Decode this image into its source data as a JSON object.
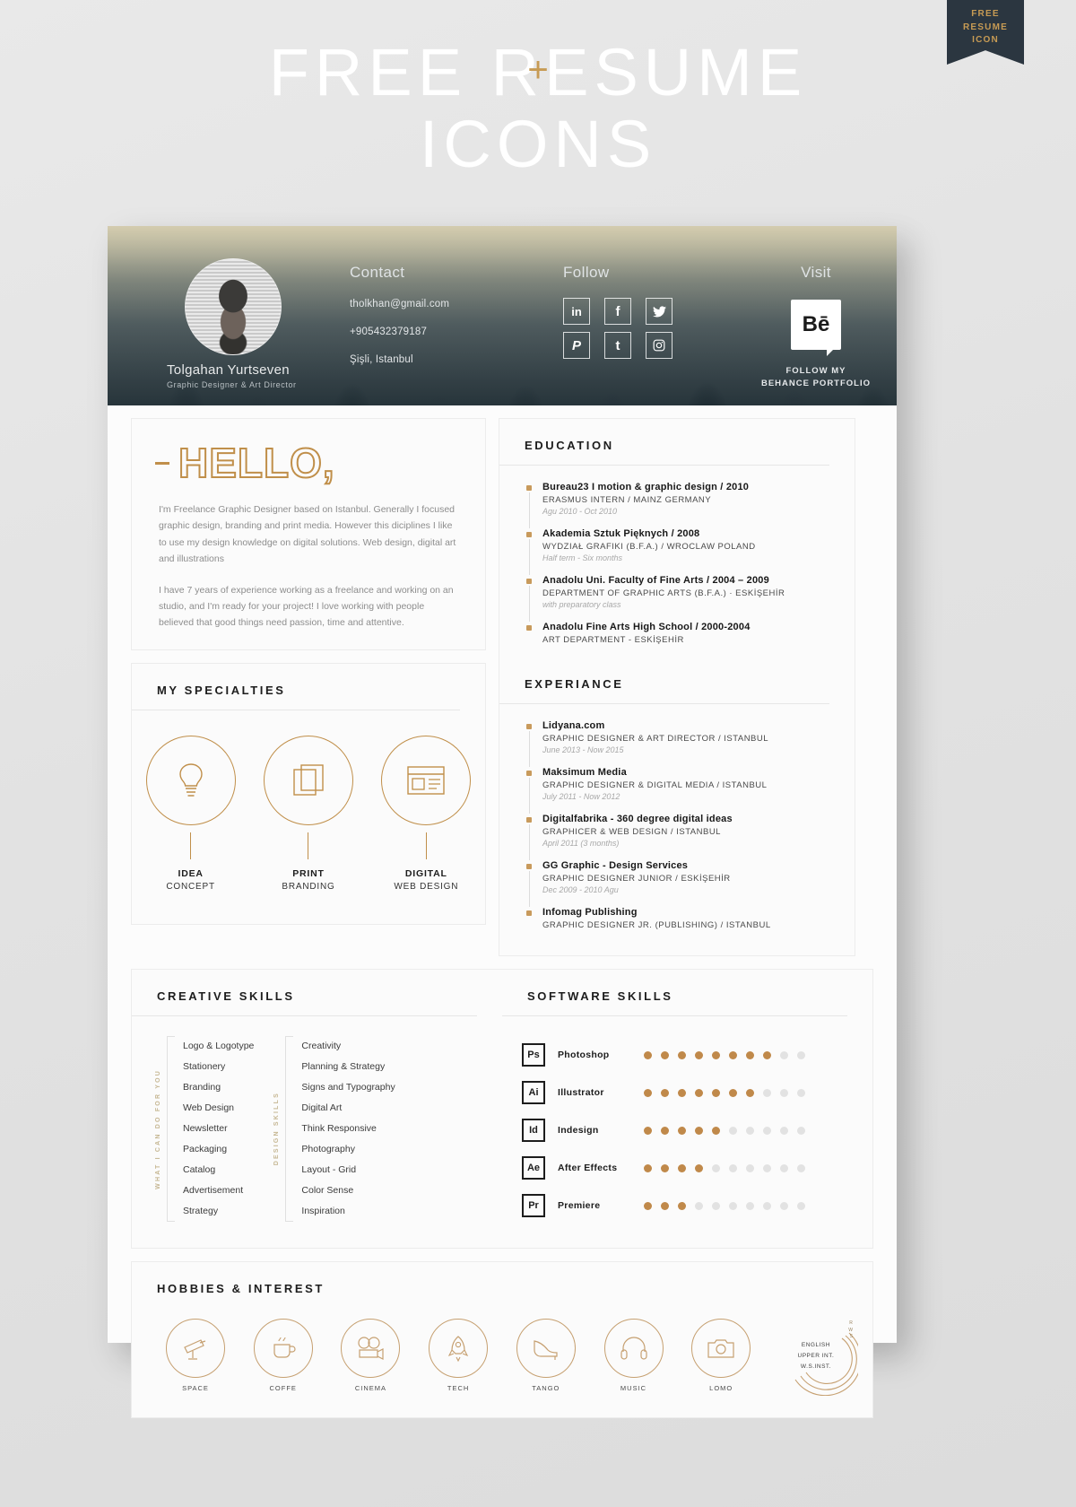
{
  "promo": {
    "line1": "FREE RESUME",
    "line2": "ICONS",
    "plus": "+",
    "ribbon": "FREE\nRESUME\nICON"
  },
  "header": {
    "name": "Tolgahan Yurtseven",
    "role": "Graphic Designer & Art Director",
    "contact_title": "Contact",
    "email": "tholkhan@gmail.com",
    "phone": "+905432379187",
    "location": "Şişli, Istanbul",
    "follow_title": "Follow",
    "socials": [
      {
        "name": "linkedin-icon",
        "glyph": "in"
      },
      {
        "name": "facebook-icon",
        "glyph": "f"
      },
      {
        "name": "twitter-icon",
        "glyph": "🐦"
      },
      {
        "name": "pinterest-icon",
        "glyph": "P"
      },
      {
        "name": "tumblr-icon",
        "glyph": "t"
      },
      {
        "name": "instagram-icon",
        "glyph": "◙"
      }
    ],
    "visit_title": "Visit",
    "behance_glyph": "Bē",
    "behance_caption": "FOLLOW MY\nBEHANCE PORTFOLIO"
  },
  "hello": {
    "dash": "",
    "word": "HELLO,",
    "paragraph1": "I'm Freelance Graphic Designer based on Istanbul. Generally I focused graphic design, branding and print media. However this diciplines I like to use my design knowledge on digital solutions. Web design, digital art and illustrations",
    "paragraph2": "I have 7 years of experience working as a freelance and working on an studio, and I'm ready for your project! I love working with people believed that good things need passion, time and attentive."
  },
  "specialties": {
    "title": "MY SPECIALTIES",
    "items": [
      {
        "icon": "lightbulb-icon",
        "line1": "IDEA",
        "line2": "CONCEPT"
      },
      {
        "icon": "pages-icon",
        "line1": "PRINT",
        "line2": "BRANDING"
      },
      {
        "icon": "browser-window-icon",
        "line1": "DIGITAL",
        "line2": "WEB DESIGN"
      }
    ]
  },
  "education": {
    "title": "EDUCATION",
    "items": [
      {
        "heading": "Bureau23 I motion & graphic design / 2010",
        "subheading": "ERASMUS INTERN / MAINZ GERMANY",
        "dates": "Agu 2010 - Oct 2010"
      },
      {
        "heading": "Akademia Sztuk Pięknych / 2008",
        "subheading": "WYDZIAŁ GRAFIKI  (B.F.A.)  /  WROCLAW POLAND",
        "dates": "Half term - Six months"
      },
      {
        "heading": "Anadolu Uni. Faculty of Fine Arts / 2004 – 2009",
        "subheading": "DEPARTMENT OF GRAPHIC ARTS  (B.F.A.) · ESKİŞEHİR",
        "dates": "with preparatory class"
      },
      {
        "heading": "Anadolu Fine Arts High School / 2000-2004",
        "subheading": "ART DEPARTMENT - ESKİŞEHİR",
        "dates": ""
      }
    ]
  },
  "experience": {
    "title": "EXPERIANCE",
    "items": [
      {
        "heading": "Lidyana.com",
        "subheading": "GRAPHIC DESIGNER & ART DIRECTOR / ISTANBUL",
        "dates": "June 2013 - Now 2015"
      },
      {
        "heading": "Maksimum Media",
        "subheading": "GRAPHIC DESIGNER & DIGITAL MEDIA / ISTANBUL",
        "dates": "July 2011 - Now 2012"
      },
      {
        "heading": "Digitalfabrika - 360 degree digital ideas",
        "subheading": "GRAPHICER & WEB DESIGN / ISTANBUL",
        "dates": "April 2011 (3 months)"
      },
      {
        "heading": "GG Graphic - Design Services",
        "subheading": "GRAPHIC DESIGNER JUNIOR / ESKİŞEHİR",
        "dates": "Dec 2009 - 2010 Agu"
      },
      {
        "heading": "Infomag Publishing",
        "subheading": "GRAPHIC DESIGNER JR. (PUBLISHING) / ISTANBUL",
        "dates": ""
      }
    ]
  },
  "creative_skills": {
    "title": "CREATIVE SKILLS",
    "column1_label": "WHAT I CAN DO FOR YOU",
    "column1": [
      "Logo & Logotype",
      "Stationery",
      "Branding",
      "Web Design",
      "Newsletter",
      "Packaging",
      "Catalog",
      "Advertisement",
      "Strategy"
    ],
    "column2_label": "DESIGN SKILLS",
    "column2": [
      "Creativity",
      "Planning & Strategy",
      "Signs and Typography",
      "Digital Art",
      "Think Responsive",
      "Photography",
      "Layout - Grid",
      "Color Sense",
      "Inspiration"
    ]
  },
  "software_skills": {
    "title": "SOFTWARE SKILLS",
    "max_dots": 10,
    "items": [
      {
        "badge": "Ps",
        "name": "Photoshop",
        "level": 8
      },
      {
        "badge": "Ai",
        "name": "Illustrator",
        "level": 7
      },
      {
        "badge": "Id",
        "name": "Indesign",
        "level": 5
      },
      {
        "badge": "Ae",
        "name": "After Effects",
        "level": 4
      },
      {
        "badge": "Pr",
        "name": "Premiere",
        "level": 3
      }
    ]
  },
  "hobbies": {
    "title": "HOBBIES & INTEREST",
    "items": [
      {
        "icon": "telescope-icon",
        "label": "SPACE"
      },
      {
        "icon": "coffee-cup-icon",
        "label": "COFFE"
      },
      {
        "icon": "film-camera-icon",
        "label": "CINEMA"
      },
      {
        "icon": "rocket-icon",
        "label": "TECH"
      },
      {
        "icon": "high-heel-icon",
        "label": "TANGO"
      },
      {
        "icon": "headphones-icon",
        "label": "MUSIC"
      },
      {
        "icon": "photo-camera-icon",
        "label": "LOMO"
      }
    ],
    "languages": {
      "lines": "ENGLISH\nUPPER INT.\nW.S.INST.",
      "tiny": "R\nW\nS"
    }
  },
  "colors": {
    "accent": "#c08f4a",
    "dark": "#2b3640",
    "dot_on": "#c0894a",
    "dot_off": "#e2e2e2"
  }
}
